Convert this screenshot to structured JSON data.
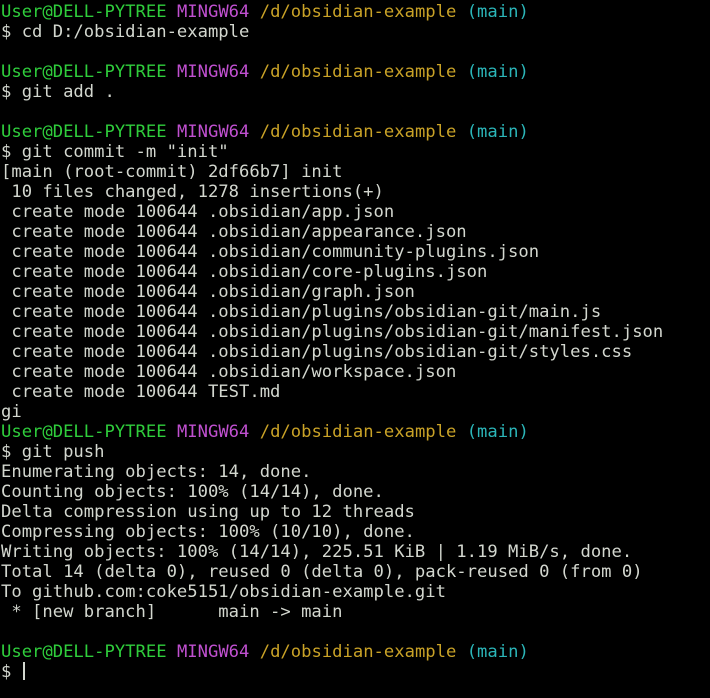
{
  "colors": {
    "background": "#000000",
    "text": "#d3d7cf",
    "prompt_user": "#2fce3c",
    "prompt_system": "#c050d0",
    "prompt_path": "#c9a227",
    "prompt_branch": "#2bb5b8"
  },
  "prompt": {
    "user": "User@DELL-PYTREE",
    "system": "MINGW64",
    "path": "/d/obsidian-example",
    "branch": "(main)"
  },
  "blocks": [
    {
      "command": "$ cd D:/obsidian-example",
      "output": [],
      "trailing_blank": true
    },
    {
      "command": "$ git add .",
      "output": [],
      "trailing_blank": true
    },
    {
      "command": "$ git commit -m \"init\"",
      "output": [
        "[main (root-commit) 2df66b7] init",
        " 10 files changed, 1278 insertions(+)",
        " create mode 100644 .obsidian/app.json",
        " create mode 100644 .obsidian/appearance.json",
        " create mode 100644 .obsidian/community-plugins.json",
        " create mode 100644 .obsidian/core-plugins.json",
        " create mode 100644 .obsidian/graph.json",
        " create mode 100644 .obsidian/plugins/obsidian-git/main.js",
        " create mode 100644 .obsidian/plugins/obsidian-git/manifest.json",
        " create mode 100644 .obsidian/plugins/obsidian-git/styles.css",
        " create mode 100644 .obsidian/workspace.json",
        " create mode 100644 TEST.md",
        "gi"
      ],
      "trailing_blank": false
    },
    {
      "command": "$ git push",
      "output": [
        "Enumerating objects: 14, done.",
        "Counting objects: 100% (14/14), done.",
        "Delta compression using up to 12 threads",
        "Compressing objects: 100% (10/10), done.",
        "Writing objects: 100% (14/14), 225.51 KiB | 1.19 MiB/s, done.",
        "Total 14 (delta 0), reused 0 (delta 0), pack-reused 0 (from 0)",
        "To github.com:coke5151/obsidian-example.git",
        " * [new branch]      main -> main"
      ],
      "trailing_blank": true
    }
  ],
  "final_prompt": {
    "input": "$ "
  }
}
